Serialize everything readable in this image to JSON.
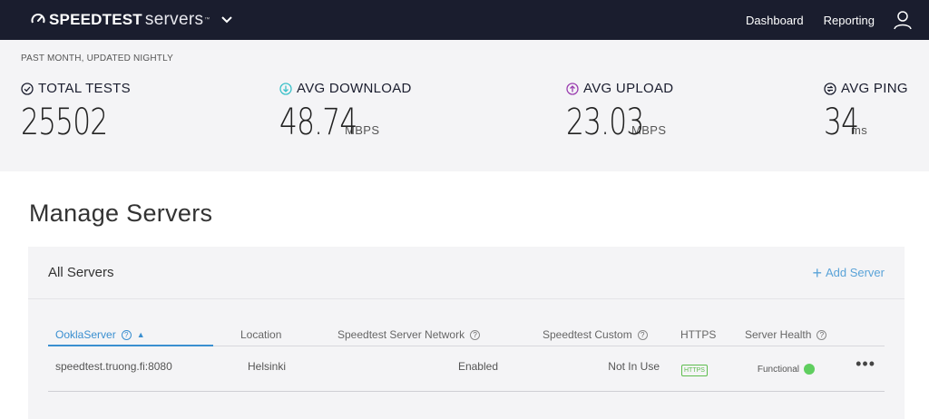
{
  "brand": {
    "strong": "SPEEDTEST",
    "light": "servers",
    "tm": "™"
  },
  "nav": {
    "dashboard": "Dashboard",
    "reporting": "Reporting"
  },
  "stats": {
    "period": "PAST MONTH, UPDATED NIGHTLY",
    "total_tests": {
      "label": "TOTAL TESTS",
      "value": "25502",
      "unit": ""
    },
    "avg_download": {
      "label": "AVG DOWNLOAD",
      "value": "48.74",
      "unit": "MBPS"
    },
    "avg_upload": {
      "label": "AVG UPLOAD",
      "value": "23.03",
      "unit": "MBPS"
    },
    "avg_ping": {
      "label": "AVG PING",
      "value": "34",
      "unit": "ms"
    }
  },
  "colors": {
    "topbar": "#1a1d2e",
    "download": "#3cc1c9",
    "upload": "#9b3fb0",
    "link": "#3a8fd0",
    "healthy": "#5fce5f"
  },
  "page": {
    "title": "Manage Servers"
  },
  "card": {
    "title": "All Servers",
    "add_label": "Add Server"
  },
  "table": {
    "headers": {
      "server": "OoklaServer",
      "location": "Location",
      "network": "Speedtest Server Network",
      "custom": "Speedtest Custom",
      "https": "HTTPS",
      "health": "Server Health"
    },
    "rows": [
      {
        "server": "speedtest.truong.fi:8080",
        "location": "Helsinki",
        "network": "Enabled",
        "custom": "Not In Use",
        "https": "HTTPS",
        "health": "Functional"
      }
    ],
    "more": "•••"
  }
}
